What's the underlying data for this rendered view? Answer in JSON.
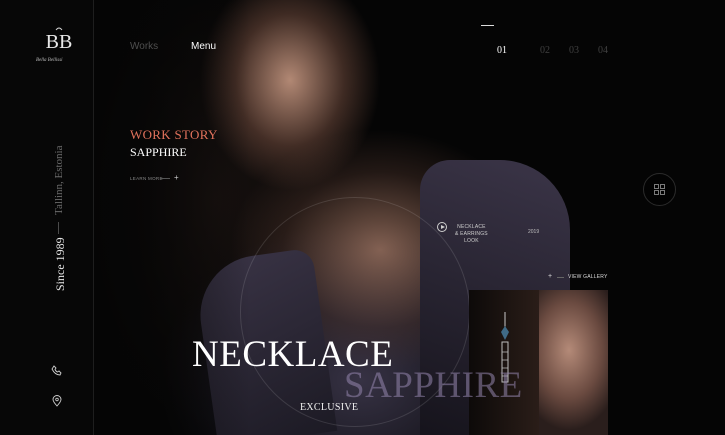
{
  "brand": {
    "logo_text": "BB",
    "subtitle": "Bella Bellissi"
  },
  "sidebar": {
    "city": "Tallinn, Estonia",
    "since": "Since 1989"
  },
  "nav": {
    "works": "Works",
    "menu": "Menu"
  },
  "slides": {
    "items": [
      "01",
      "02",
      "03",
      "04"
    ],
    "active": "01"
  },
  "story": {
    "title": "WORK STORY",
    "subtitle": "SAPPHIRE",
    "learn_more": "LEARN MORE",
    "plus": "+"
  },
  "video": {
    "line1": "NECKLACE",
    "line2": "& EARRINGS",
    "line3": "LOOK",
    "year": "2019"
  },
  "gallery": {
    "plus": "+",
    "label": "VIEW GALLERY"
  },
  "hero": {
    "title": "NECKLACE",
    "title2": "SAPPHIRE",
    "tagline": "EXCLUSIVE"
  },
  "colors": {
    "accent": "#e2725c",
    "background": "#060606"
  },
  "icons": [
    "logo-icon",
    "phone-icon",
    "location-pin-icon",
    "grid-icon",
    "play-icon"
  ]
}
